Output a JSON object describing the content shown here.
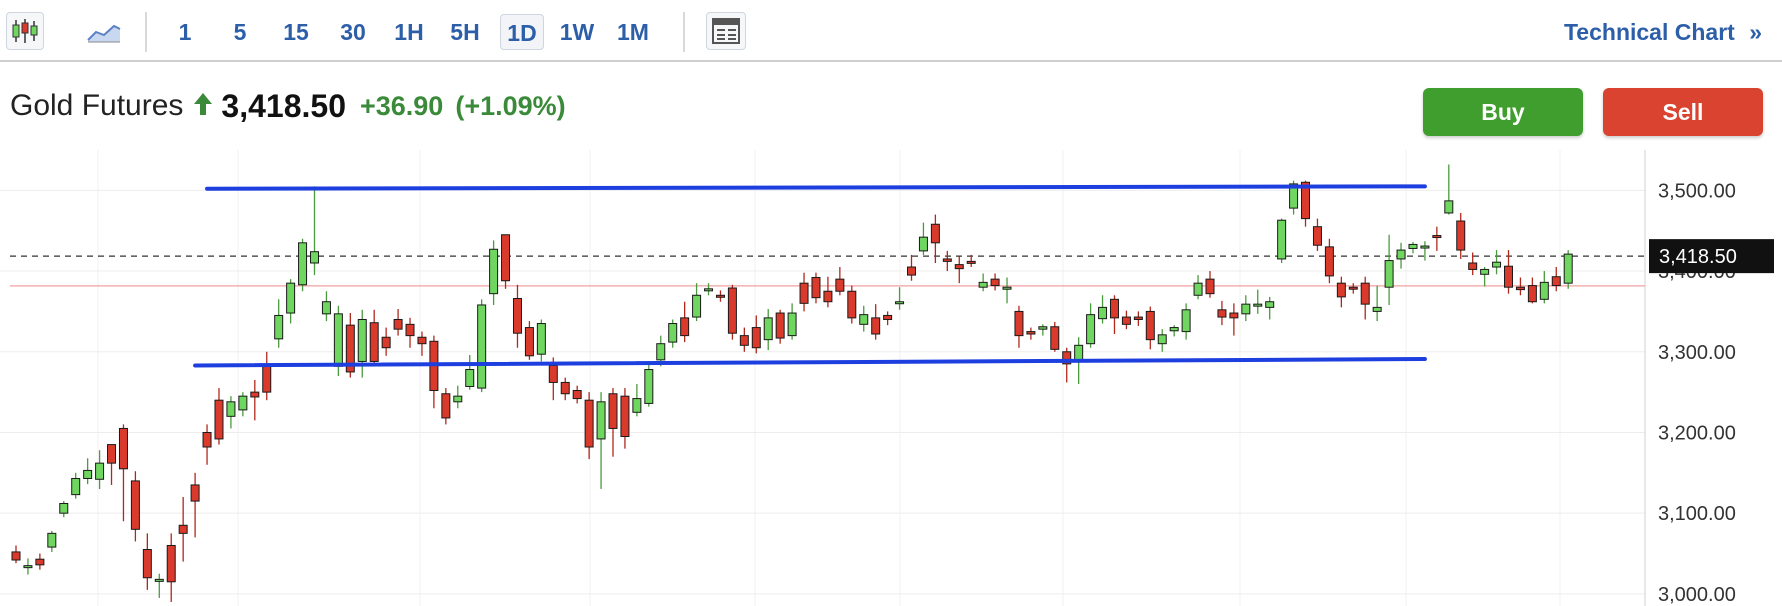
{
  "toolbar": {
    "chart_type_icon": "candlestick-icon",
    "line_type_icon": "area-chart-icon",
    "intervals": [
      "1",
      "5",
      "15",
      "30",
      "1H",
      "5H",
      "1D",
      "1W",
      "1M"
    ],
    "active_interval": "1D",
    "layout_icon": "layout-icon",
    "technical_chart_label": "Technical Chart",
    "technical_chart_chevron": "»"
  },
  "quote": {
    "name": "Gold Futures",
    "direction_icon": "arrow-up-icon",
    "price": "3,418.50",
    "change": "+36.90",
    "change_pct": "(+1.09%)",
    "color_up": "#3a8a3a"
  },
  "actions": {
    "buy_label": "Buy",
    "sell_label": "Sell",
    "buy_color": "#3f9e2e",
    "sell_color": "#d9432f"
  },
  "chart_data": {
    "type": "candlestick",
    "y_ticks": [
      "3,500.00",
      "3,400.00",
      "3,300.00",
      "3,200.00",
      "3,100.00",
      "3,000.00"
    ],
    "y_tick_values": [
      3500,
      3400,
      3300,
      3200,
      3100,
      3000
    ],
    "ylim": [
      2985,
      3550
    ],
    "current_price": 3418.5,
    "current_price_label": "3,418.50",
    "prev_close": 3381.6,
    "up_color": "#6fd65f",
    "down_color": "#d93a2b",
    "trendline_color": "#1e3fe0",
    "grid": true,
    "candles": [
      [
        3052,
        3042,
        3060,
        3038
      ],
      [
        3035,
        3035,
        3044,
        3024
      ],
      [
        3043,
        3036,
        3050,
        3030
      ],
      [
        3058,
        3075,
        3078,
        3052
      ],
      [
        3100,
        3112,
        3115,
        3095
      ],
      [
        3123,
        3143,
        3150,
        3118
      ],
      [
        3143,
        3153,
        3168,
        3136
      ],
      [
        3142,
        3162,
        3178,
        3130
      ],
      [
        3185,
        3162,
        3170,
        3135
      ],
      [
        3205,
        3155,
        3210,
        3090
      ],
      [
        3140,
        3080,
        3152,
        3065
      ],
      [
        3055,
        3020,
        3075,
        3005
      ],
      [
        3018,
        3018,
        3025,
        2995
      ],
      [
        3060,
        3015,
        3075,
        2990
      ],
      [
        3085,
        3075,
        3120,
        3040
      ],
      [
        3135,
        3115,
        3150,
        3070
      ],
      [
        3200,
        3182,
        3210,
        3160
      ],
      [
        3240,
        3192,
        3255,
        3185
      ],
      [
        3220,
        3238,
        3245,
        3205
      ],
      [
        3228,
        3245,
        3250,
        3220
      ],
      [
        3250,
        3244,
        3265,
        3215
      ],
      [
        3284,
        3250,
        3300,
        3240
      ],
      [
        3316,
        3345,
        3365,
        3305
      ],
      [
        3348,
        3385,
        3390,
        3335
      ],
      [
        3383,
        3435,
        3440,
        3375
      ],
      [
        3410,
        3424,
        3505,
        3395
      ],
      [
        3347,
        3362,
        3375,
        3338
      ],
      [
        3282,
        3347,
        3357,
        3270
      ],
      [
        3333,
        3275,
        3348,
        3268
      ],
      [
        3288,
        3340,
        3352,
        3268
      ],
      [
        3336,
        3288,
        3352,
        3282
      ],
      [
        3318,
        3305,
        3330,
        3295
      ],
      [
        3340,
        3328,
        3353,
        3320
      ],
      [
        3334,
        3320,
        3342,
        3305
      ],
      [
        3318,
        3310,
        3325,
        3295
      ],
      [
        3313,
        3252,
        3320,
        3230
      ],
      [
        3248,
        3218,
        3255,
        3210
      ],
      [
        3238,
        3245,
        3258,
        3230
      ],
      [
        3257,
        3278,
        3296,
        3253
      ],
      [
        3255,
        3358,
        3365,
        3250
      ],
      [
        3372,
        3427,
        3438,
        3358
      ],
      [
        3445,
        3388,
        3445,
        3378
      ],
      [
        3366,
        3323,
        3383,
        3305
      ],
      [
        3330,
        3295,
        3338,
        3290
      ],
      [
        3297,
        3335,
        3340,
        3288
      ],
      [
        3283,
        3262,
        3293,
        3240
      ],
      [
        3262,
        3248,
        3268,
        3240
      ],
      [
        3252,
        3242,
        3258,
        3236
      ],
      [
        3240,
        3182,
        3250,
        3167
      ],
      [
        3192,
        3238,
        3250,
        3130
      ],
      [
        3248,
        3205,
        3255,
        3170
      ],
      [
        3245,
        3195,
        3255,
        3180
      ],
      [
        3225,
        3242,
        3260,
        3220
      ],
      [
        3236,
        3278,
        3284,
        3232
      ],
      [
        3290,
        3310,
        3320,
        3282
      ],
      [
        3312,
        3335,
        3340,
        3305
      ],
      [
        3342,
        3320,
        3362,
        3312
      ],
      [
        3343,
        3370,
        3385,
        3338
      ],
      [
        3377,
        3378,
        3385,
        3370
      ],
      [
        3370,
        3368,
        3376,
        3362
      ],
      [
        3379,
        3323,
        3383,
        3315
      ],
      [
        3320,
        3308,
        3330,
        3300
      ],
      [
        3330,
        3305,
        3345,
        3298
      ],
      [
        3315,
        3342,
        3353,
        3302
      ],
      [
        3348,
        3317,
        3352,
        3310
      ],
      [
        3320,
        3348,
        3360,
        3315
      ],
      [
        3385,
        3360,
        3398,
        3350
      ],
      [
        3392,
        3367,
        3398,
        3360
      ],
      [
        3375,
        3362,
        3393,
        3355
      ],
      [
        3390,
        3375,
        3405,
        3370
      ],
      [
        3375,
        3342,
        3382,
        3335
      ],
      [
        3334,
        3346,
        3357,
        3325
      ],
      [
        3342,
        3322,
        3359,
        3315
      ],
      [
        3345,
        3340,
        3350,
        3333
      ],
      [
        3360,
        3362,
        3380,
        3352
      ],
      [
        3405,
        3395,
        3420,
        3388
      ],
      [
        3425,
        3442,
        3460,
        3420
      ],
      [
        3458,
        3435,
        3470,
        3410
      ],
      [
        3415,
        3412,
        3425,
        3400
      ],
      [
        3408,
        3403,
        3418,
        3385
      ],
      [
        3412,
        3410,
        3420,
        3405
      ],
      [
        3380,
        3386,
        3397,
        3375
      ],
      [
        3390,
        3382,
        3397,
        3376
      ],
      [
        3380,
        3380,
        3392,
        3360
      ],
      [
        3350,
        3320,
        3357,
        3305
      ],
      [
        3325,
        3322,
        3330,
        3315
      ],
      [
        3328,
        3331,
        3334,
        3320
      ],
      [
        3331,
        3303,
        3337,
        3300
      ],
      [
        3300,
        3285,
        3305,
        3262
      ],
      [
        3290,
        3308,
        3318,
        3260
      ],
      [
        3310,
        3346,
        3360,
        3305
      ],
      [
        3341,
        3355,
        3370,
        3335
      ],
      [
        3365,
        3342,
        3370,
        3322
      ],
      [
        3343,
        3334,
        3351,
        3328
      ],
      [
        3343,
        3340,
        3350,
        3332
      ],
      [
        3350,
        3315,
        3356,
        3303
      ],
      [
        3310,
        3321,
        3328,
        3300
      ],
      [
        3326,
        3330,
        3333,
        3319
      ],
      [
        3325,
        3352,
        3360,
        3315
      ],
      [
        3370,
        3385,
        3395,
        3365
      ],
      [
        3390,
        3372,
        3400,
        3367
      ],
      [
        3352,
        3343,
        3363,
        3333
      ],
      [
        3348,
        3342,
        3360,
        3320
      ],
      [
        3347,
        3359,
        3370,
        3338
      ],
      [
        3358,
        3359,
        3377,
        3347
      ],
      [
        3355,
        3362,
        3368,
        3340
      ],
      [
        3415,
        3463,
        3465,
        3410
      ],
      [
        3478,
        3508,
        3512,
        3470
      ],
      [
        3510,
        3465,
        3512,
        3455
      ],
      [
        3455,
        3432,
        3465,
        3425
      ],
      [
        3430,
        3394,
        3440,
        3385
      ],
      [
        3385,
        3368,
        3393,
        3355
      ],
      [
        3380,
        3379,
        3385,
        3372
      ],
      [
        3385,
        3359,
        3393,
        3340
      ],
      [
        3350,
        3355,
        3382,
        3338
      ],
      [
        3380,
        3413,
        3445,
        3358
      ],
      [
        3415,
        3426,
        3435,
        3403
      ],
      [
        3428,
        3433,
        3436,
        3422
      ],
      [
        3430,
        3431,
        3437,
        3413
      ],
      [
        3444,
        3442,
        3455,
        3425
      ],
      [
        3472,
        3487,
        3532,
        3470
      ],
      [
        3462,
        3426,
        3472,
        3415
      ],
      [
        3410,
        3402,
        3423,
        3395
      ],
      [
        3396,
        3402,
        3405,
        3381
      ],
      [
        3405,
        3411,
        3426,
        3396
      ],
      [
        3406,
        3380,
        3426,
        3372
      ],
      [
        3380,
        3377,
        3392,
        3370
      ],
      [
        3382,
        3362,
        3392,
        3360
      ],
      [
        3365,
        3386,
        3400,
        3360
      ],
      [
        3393,
        3382,
        3405,
        3375
      ],
      [
        3385,
        3421,
        3426,
        3378
      ]
    ],
    "trendlines": [
      {
        "from": [
          16,
          3502
        ],
        "to": [
          118,
          3505
        ]
      },
      {
        "from": [
          15,
          3283
        ],
        "to": [
          118,
          3291
        ]
      }
    ]
  }
}
